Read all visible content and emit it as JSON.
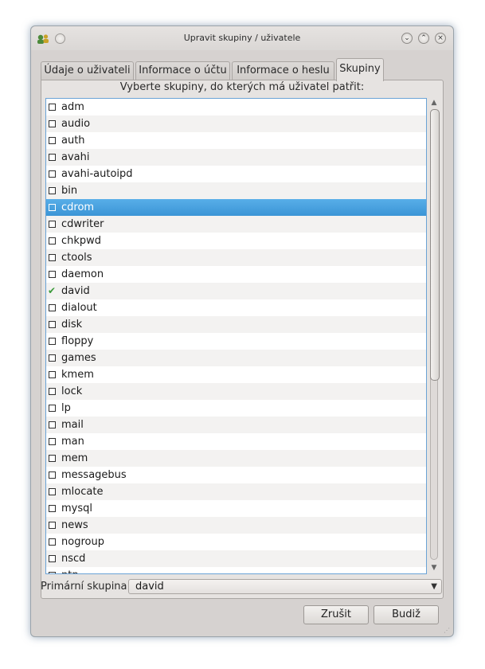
{
  "window": {
    "title": "Upravit skupiny / uživatele",
    "shade_glyph": "⌄",
    "maximize_glyph": "⌃",
    "close_glyph": "×"
  },
  "tabs": [
    {
      "label": "Údaje o uživateli",
      "active": false
    },
    {
      "label": "Informace o účtu",
      "active": false
    },
    {
      "label": "Informace o heslu",
      "active": false
    },
    {
      "label": "Skupiny",
      "active": true
    }
  ],
  "groups_panel": {
    "instruction": "Vyberte skupiny, do kterých má uživatel patřit:",
    "groups": [
      {
        "name": "adm",
        "checked": false
      },
      {
        "name": "audio",
        "checked": false
      },
      {
        "name": "auth",
        "checked": false
      },
      {
        "name": "avahi",
        "checked": false
      },
      {
        "name": "avahi-autoipd",
        "checked": false
      },
      {
        "name": "bin",
        "checked": false
      },
      {
        "name": "cdrom",
        "checked": false,
        "selected": true
      },
      {
        "name": "cdwriter",
        "checked": false
      },
      {
        "name": "chkpwd",
        "checked": false
      },
      {
        "name": "ctools",
        "checked": false
      },
      {
        "name": "daemon",
        "checked": false
      },
      {
        "name": "david",
        "checked": true
      },
      {
        "name": "dialout",
        "checked": false
      },
      {
        "name": "disk",
        "checked": false
      },
      {
        "name": "floppy",
        "checked": false
      },
      {
        "name": "games",
        "checked": false
      },
      {
        "name": "kmem",
        "checked": false
      },
      {
        "name": "lock",
        "checked": false
      },
      {
        "name": "lp",
        "checked": false
      },
      {
        "name": "mail",
        "checked": false
      },
      {
        "name": "man",
        "checked": false
      },
      {
        "name": "mem",
        "checked": false
      },
      {
        "name": "messagebus",
        "checked": false
      },
      {
        "name": "mlocate",
        "checked": false
      },
      {
        "name": "mysql",
        "checked": false
      },
      {
        "name": "news",
        "checked": false
      },
      {
        "name": "nogroup",
        "checked": false
      },
      {
        "name": "nscd",
        "checked": false
      },
      {
        "name": "ntp",
        "checked": false
      }
    ]
  },
  "primary_group": {
    "label": "Primární skupina",
    "value": "david"
  },
  "buttons": {
    "cancel": "Zrušit",
    "ok": "Budiž"
  },
  "icons": {
    "app": "user-groups-icon",
    "check": "checkmark-icon",
    "dropdown": "chevron-down-icon"
  },
  "colors": {
    "selection": "#3b95d6",
    "check": "#3a9a3a",
    "frame_focus": "#6aa3d6"
  }
}
